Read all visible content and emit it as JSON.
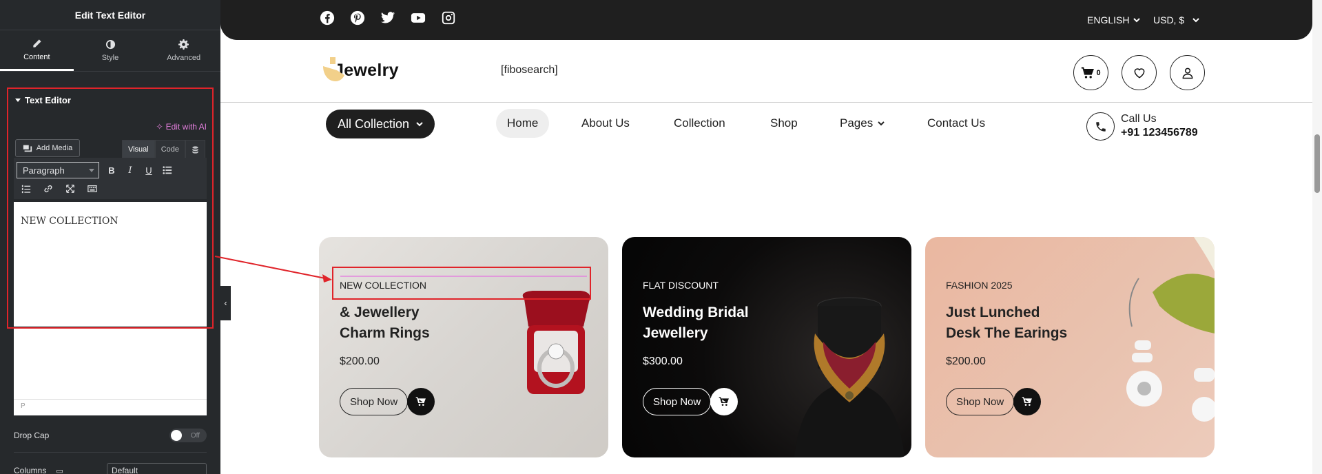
{
  "panel": {
    "header_title": "Edit Text Editor",
    "tabs": [
      {
        "label": "Content",
        "icon": "pencil-icon",
        "active": true
      },
      {
        "label": "Style",
        "icon": "contrast-icon",
        "active": false
      },
      {
        "label": "Advanced",
        "icon": "gear-icon",
        "active": false
      }
    ],
    "section_title": "Text Editor",
    "edit_with_ai": "Edit with AI",
    "add_media": "Add Media",
    "visual_tab": "Visual",
    "code_tab": "Code",
    "format_select": "Paragraph",
    "editor_content": "NEW COLLECTION",
    "editor_status": "P",
    "drop_cap_label": "Drop Cap",
    "drop_cap_toggle": "Off",
    "columns_label": "Columns",
    "columns_value": "Default"
  },
  "site": {
    "topbar": {
      "language": "ENGLISH",
      "currency": "USD, $"
    },
    "logo_text": "Jewelry",
    "search_shortcode": "[fibosearch]",
    "cart_count": "0",
    "nav": {
      "all_collection": "All Collection",
      "items": [
        "Home",
        "About Us",
        "Collection",
        "Shop",
        "Pages",
        "Contact Us"
      ]
    },
    "call": {
      "label": "Call Us",
      "number": "+91 123456789"
    },
    "cards": [
      {
        "tag": "NEW COLLECTION",
        "title_line1": "& Jewellery",
        "title_line2": "Charm Rings",
        "price": "$200.00",
        "button": "Shop Now"
      },
      {
        "tag": "FLAT DISCOUNT",
        "title_line1": "Wedding Bridal",
        "title_line2": "Jewellery",
        "price": "$300.00",
        "button": "Shop Now"
      },
      {
        "tag": "FASHION 2025",
        "title_line1": "Just Lunched",
        "title_line2": "Desk The Earings",
        "price": "$200.00",
        "button": "Shop Now"
      }
    ]
  },
  "colors": {
    "panel_bg": "#26292c",
    "highlight_red": "#e0242a",
    "ai_pink": "#e47fde",
    "site_dark": "#1f1f1f"
  }
}
